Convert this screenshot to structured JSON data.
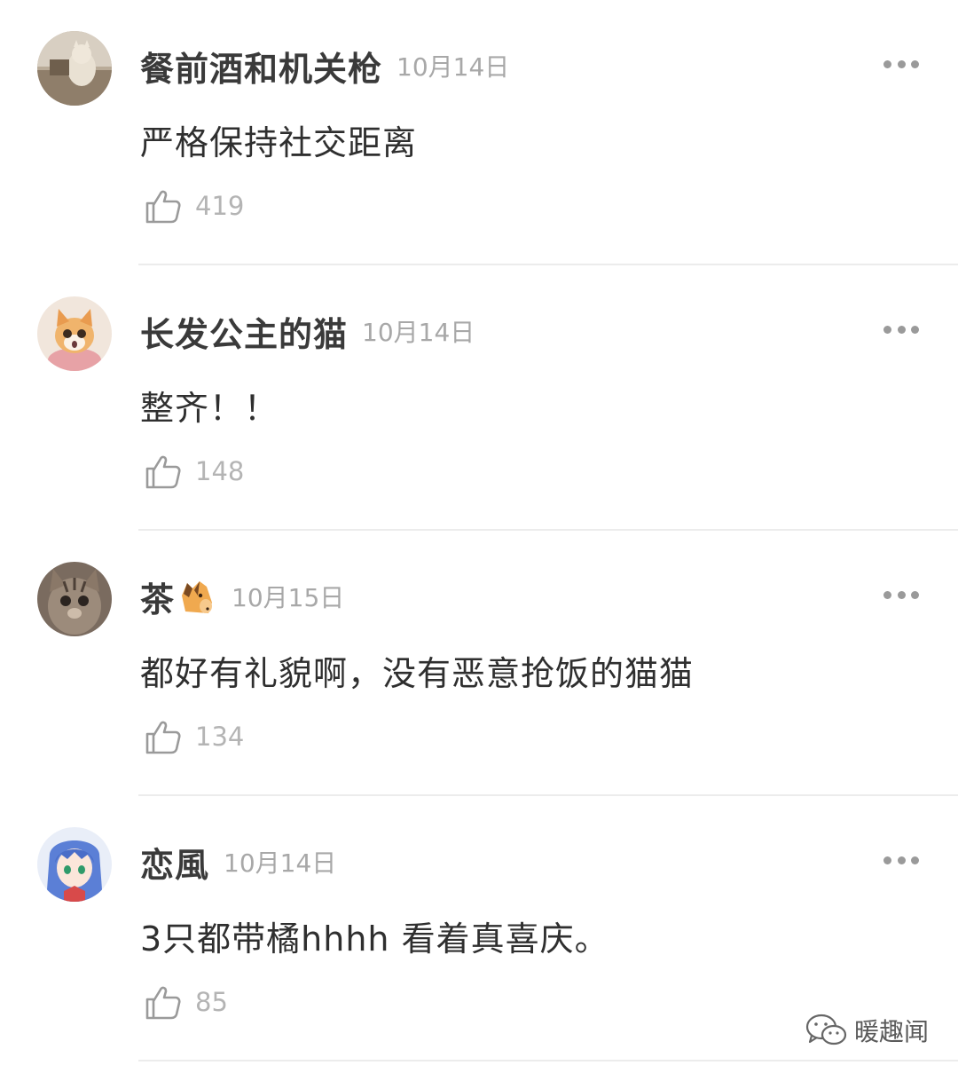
{
  "comments": [
    {
      "username": "餐前酒和机关枪",
      "date": "10月14日",
      "text": "严格保持社交距离",
      "likes": "419",
      "avatar": "cat-photo-avatar"
    },
    {
      "username": "长发公主的猫",
      "date": "10月14日",
      "text": "整齐！！",
      "likes": "148",
      "avatar": "kitten-photo-avatar"
    },
    {
      "username": "茶",
      "username_emoji": "horse-face-emoji",
      "date": "10月15日",
      "text": "都好有礼貌啊，没有恶意抢饭的猫猫",
      "likes": "134",
      "avatar": "tabby-cat-avatar"
    },
    {
      "username": "恋風",
      "date": "10月14日",
      "text": "3只都带橘hhhh 看着真喜庆。",
      "likes": "85",
      "avatar": "anime-girl-avatar"
    }
  ],
  "watermark": {
    "text": "暖趣闻",
    "icon": "wechat-icon"
  },
  "colors": {
    "username": "#3a3a3a",
    "date": "#a8a8a8",
    "likes": "#b4b4b4",
    "divider": "#ececec"
  }
}
